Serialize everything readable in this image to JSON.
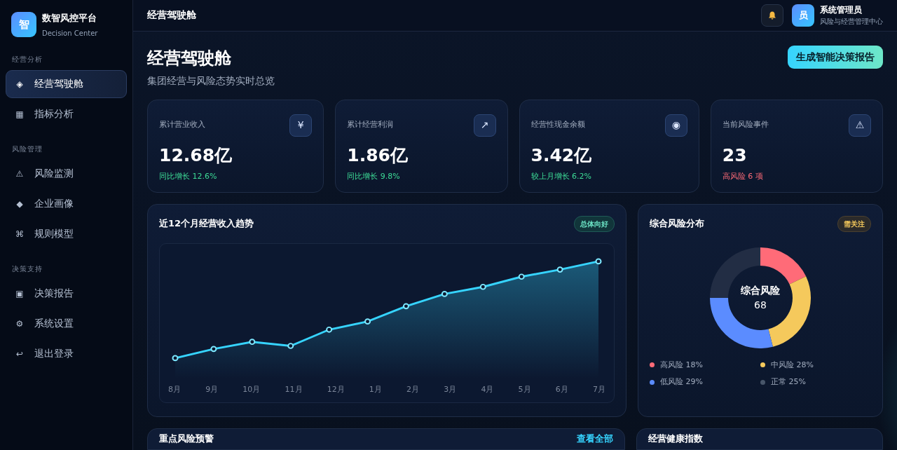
{
  "brand": {
    "logo": "智",
    "name": "数智风控平台",
    "subtitle": "Decision Center"
  },
  "sidebar": {
    "sections": [
      {
        "title": "经营分析",
        "items": [
          {
            "icon": "◈",
            "label": "经营驾驶舱",
            "selected": true
          },
          {
            "icon": "▦",
            "label": "指标分析",
            "selected": false
          }
        ]
      },
      {
        "title": "风险管理",
        "items": [
          {
            "icon": "⚠",
            "label": "风险监测",
            "selected": false
          },
          {
            "icon": "◆",
            "label": "企业画像",
            "selected": false
          },
          {
            "icon": "⌘",
            "label": "规则模型",
            "selected": false
          }
        ]
      },
      {
        "title": "决策支持",
        "items": [
          {
            "icon": "▣",
            "label": "决策报告",
            "selected": false
          },
          {
            "icon": "⚙",
            "label": "系统设置",
            "selected": false
          },
          {
            "icon": "↩",
            "label": "退出登录",
            "selected": false
          }
        ]
      }
    ]
  },
  "topbar": {
    "title": "经营驾驶舱",
    "user": {
      "avatar": "员",
      "name": "系统管理员",
      "role": "风险与经营管理中心"
    }
  },
  "page": {
    "title": "经营驾驶舱",
    "subtitle": "集团经营与风险态势实时总览",
    "action": "生成智能决策报告"
  },
  "kpis": [
    {
      "label": "累计营业收入",
      "icon": "¥",
      "value": "12.68亿",
      "delta": "同比增长 12.6%",
      "alert": false
    },
    {
      "label": "累计经营利润",
      "icon": "↗",
      "value": "1.86亿",
      "delta": "同比增长 9.8%",
      "alert": false
    },
    {
      "label": "经营性现金余额",
      "icon": "◉",
      "value": "3.42亿",
      "delta": "较上月增长 6.2%",
      "alert": false
    },
    {
      "label": "当前风险事件",
      "icon": "⚠",
      "value": "23",
      "delta": "高风险 6 项",
      "alert": true
    }
  ],
  "trend_panel": {
    "title": "近12个月经营收入趋势",
    "badge": "总体向好",
    "months": [
      "8月",
      "9月",
      "10月",
      "11月",
      "12月",
      "1月",
      "2月",
      "3月",
      "4月",
      "5月",
      "6月",
      "7月"
    ]
  },
  "risk_panel": {
    "title": "综合风险分布",
    "badge": "需关注",
    "center_label": "综合风险",
    "center_value": "68",
    "legend": [
      {
        "color": "#ff6b78"
      },
      {
        "color": "#f5c95c"
      },
      {
        "color": "#5b8cff"
      },
      {
        "color": "#475569"
      }
    ],
    "chart_data": {
      "type": "donut",
      "categories": [
        "高风险",
        "中风险",
        "低风险",
        "正常"
      ],
      "values": [
        18,
        28,
        29,
        25
      ],
      "value_labels": [
        "18%",
        "28%",
        "29%",
        "25%"
      ]
    }
  },
  "bottom": {
    "alerts_title": "重点风险预警",
    "alerts_link": "查看全部",
    "health_title": "经营健康指数"
  }
}
